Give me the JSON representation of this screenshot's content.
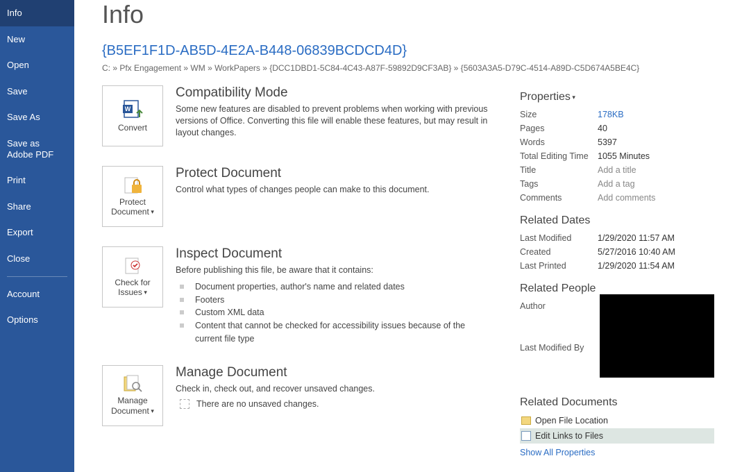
{
  "sidebar": {
    "items": [
      {
        "label": "Info"
      },
      {
        "label": "New"
      },
      {
        "label": "Open"
      },
      {
        "label": "Save"
      },
      {
        "label": "Save As"
      },
      {
        "label": "Save as Adobe PDF"
      },
      {
        "label": "Print"
      },
      {
        "label": "Share"
      },
      {
        "label": "Export"
      },
      {
        "label": "Close"
      }
    ],
    "bottom": [
      {
        "label": "Account"
      },
      {
        "label": "Options"
      }
    ]
  },
  "page": {
    "title": "Info",
    "docName": "{B5EF1F1D-AB5D-4E2A-B448-06839BCDCD4D}",
    "path": "C: » Pfx Engagement » WM » WorkPapers » {DCC1DBD1-5C84-4C43-A87F-59892D9CF3AB} » {5603A3A5-D79C-4514-A89D-C5D674A5BE4C}"
  },
  "blocks": {
    "compat": {
      "button": "Convert",
      "heading": "Compatibility Mode",
      "desc": "Some new features are disabled to prevent problems when working with previous versions of Office. Converting this file will enable these features, but may result in layout changes."
    },
    "protect": {
      "button": "Protect Document",
      "heading": "Protect Document",
      "desc": "Control what types of changes people can make to this document."
    },
    "inspect": {
      "button": "Check for Issues",
      "heading": "Inspect Document",
      "desc": "Before publishing this file, be aware that it contains:",
      "items": [
        "Document properties, author's name and related dates",
        "Footers",
        "Custom XML data",
        "Content that cannot be checked for accessibility issues because of the current file type"
      ]
    },
    "manage": {
      "button": "Manage Document",
      "heading": "Manage Document",
      "desc": "Check in, check out, and recover unsaved changes.",
      "none": "There are no unsaved changes."
    }
  },
  "right": {
    "propsHeading": "Properties",
    "props": {
      "size": {
        "label": "Size",
        "value": "178KB"
      },
      "pages": {
        "label": "Pages",
        "value": "40"
      },
      "words": {
        "label": "Words",
        "value": "5397"
      },
      "editTime": {
        "label": "Total Editing Time",
        "value": "1055 Minutes"
      },
      "titleProp": {
        "label": "Title",
        "value": "Add a title"
      },
      "tags": {
        "label": "Tags",
        "value": "Add a tag"
      },
      "comments": {
        "label": "Comments",
        "value": "Add comments"
      }
    },
    "datesHeading": "Related Dates",
    "dates": {
      "modified": {
        "label": "Last Modified",
        "value": "1/29/2020 11:57 AM"
      },
      "created": {
        "label": "Created",
        "value": "5/27/2016 10:40 AM"
      },
      "printed": {
        "label": "Last Printed",
        "value": "1/29/2020 11:54 AM"
      }
    },
    "peopleHeading": "Related People",
    "people": {
      "author": "Author",
      "lastModBy": "Last Modified By"
    },
    "docsHeading": "Related Documents",
    "docs": {
      "openLoc": "Open File Location",
      "editLinks": "Edit Links to Files",
      "showAll": "Show All Properties"
    }
  }
}
